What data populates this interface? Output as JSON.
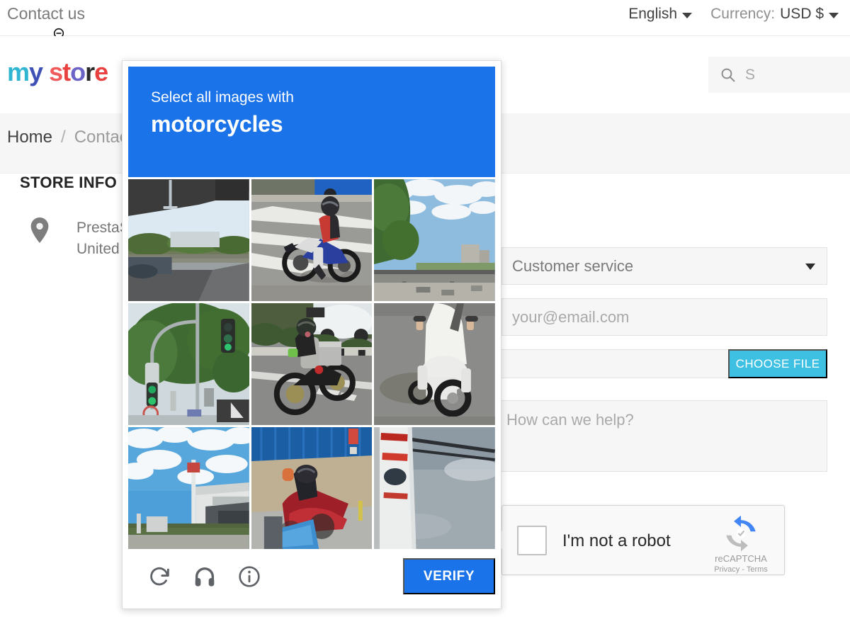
{
  "topnav": {
    "contact_label": "Contact us",
    "language": "English",
    "currency_label": "Currency:",
    "currency_value": "USD $",
    "cursor_icon": "zoom-out-cursor"
  },
  "header": {
    "logo_text": "my store",
    "logo_letters": [
      "m",
      "y",
      " ",
      "s",
      "t",
      "o",
      "r",
      "e"
    ],
    "search_placeholder": "S",
    "search_icon": "search-icon"
  },
  "breadcrumb": {
    "home": "Home",
    "separator": "/",
    "current": "Contac"
  },
  "store_info": {
    "title": "STORE INFO",
    "pin_icon": "map-pin-icon",
    "address_line1": "PrestaS",
    "address_line2": "United S"
  },
  "form": {
    "subject_value": "Customer service",
    "subject_caret_icon": "chevron-down-icon",
    "email_placeholder": "your@email.com",
    "file_value": "",
    "choose_file_label": "CHOOSE FILE",
    "message_placeholder": "How can we help?"
  },
  "recaptcha_widget": {
    "label": "I'm not a robot",
    "brand": "reCAPTCHA",
    "terms": "Privacy - Terms",
    "logo_icon": "recaptcha-logo-icon",
    "checkbox_checked": false
  },
  "captcha": {
    "prompt_line1": "Select all images with",
    "prompt_line2": "motorcycles",
    "header_color": "#1a73e8",
    "verify_label": "VERIFY",
    "reload_icon": "reload-icon",
    "audio_icon": "headphones-icon",
    "info_icon": "info-icon",
    "tiles": [
      {
        "id": 1,
        "alt": "motorcycles parked under overpass",
        "selected": false
      },
      {
        "id": 2,
        "alt": "rider on blue motorcycle on crosswalk",
        "selected": false
      },
      {
        "id": 3,
        "alt": "highway overpass with clouds",
        "selected": false
      },
      {
        "id": 4,
        "alt": "traffic light at intersection with trees",
        "selected": false
      },
      {
        "id": 5,
        "alt": "motorcycle with delivery top box",
        "selected": false
      },
      {
        "id": 6,
        "alt": "rider in white on scooter",
        "selected": false
      },
      {
        "id": 7,
        "alt": "building under blue cloudy sky",
        "selected": false
      },
      {
        "id": 8,
        "alt": "red scooter against blue corrugated wall",
        "selected": false
      },
      {
        "id": 9,
        "alt": "sign board against grey sky with wires",
        "selected": false
      }
    ]
  }
}
